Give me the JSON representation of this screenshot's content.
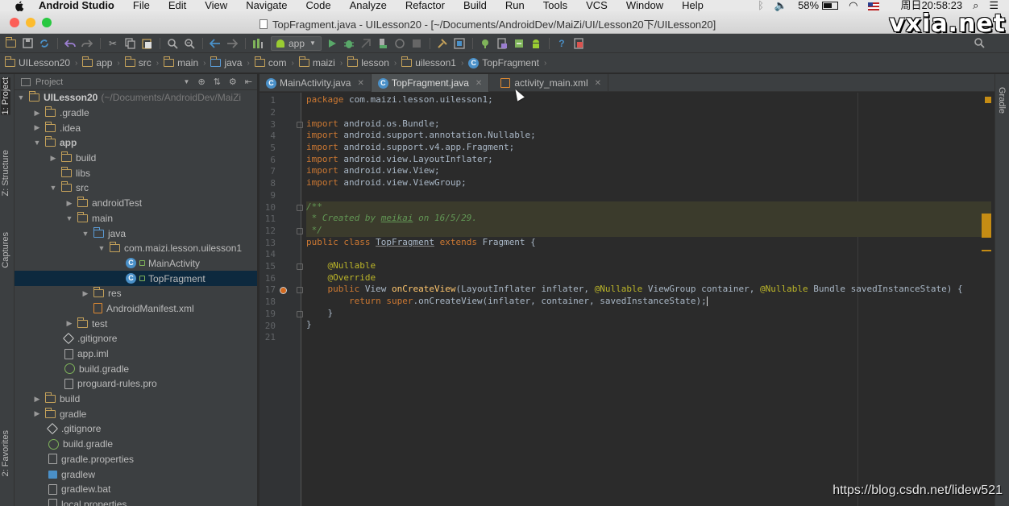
{
  "menubar": {
    "app": "Android Studio",
    "items": [
      "File",
      "Edit",
      "View",
      "Navigate",
      "Code",
      "Analyze",
      "Refactor",
      "Build",
      "Run",
      "Tools",
      "VCS",
      "Window",
      "Help"
    ],
    "battery": "58%",
    "clock": "周日20:58:23"
  },
  "window": {
    "title": "TopFragment.java - UILesson20 - [~/Documents/AndroidDev/MaiZi/UI/Lesson20下/UILesson20]"
  },
  "watermarks": {
    "top": "vxia.net",
    "bottom": "https://blog.csdn.net/lidew521"
  },
  "toolbar": {
    "run_config": "app"
  },
  "breadcrumb": [
    "UILesson20",
    "app",
    "src",
    "main",
    "java",
    "com",
    "maizi",
    "lesson",
    "uilesson1",
    "TopFragment"
  ],
  "left_tabs": {
    "project": "1: Project",
    "structure": "Z: Structure",
    "captures": "Captures",
    "favorites": "2: Favorites"
  },
  "right_tabs": {
    "gradle": "Gradle"
  },
  "project_panel": {
    "header": "Project",
    "root_name": "UILesson20",
    "root_path": "(~/Documents/AndroidDev/MaiZi",
    "items": [
      {
        "label": ".gradle"
      },
      {
        "label": ".idea"
      },
      {
        "label": "app"
      },
      {
        "label": "build"
      },
      {
        "label": "libs"
      },
      {
        "label": "src"
      },
      {
        "label": "androidTest"
      },
      {
        "label": "main"
      },
      {
        "label": "java"
      },
      {
        "label": "com.maizi.lesson.uilesson1"
      },
      {
        "label": "MainActivity"
      },
      {
        "label": "TopFragment"
      },
      {
        "label": "res"
      },
      {
        "label": "AndroidManifest.xml"
      },
      {
        "label": "test"
      },
      {
        "label": ".gitignore"
      },
      {
        "label": "app.iml"
      },
      {
        "label": "build.gradle"
      },
      {
        "label": "proguard-rules.pro"
      },
      {
        "label": "build"
      },
      {
        "label": "gradle"
      },
      {
        "label": ".gitignore"
      },
      {
        "label": "build.gradle"
      },
      {
        "label": "gradle.properties"
      },
      {
        "label": "gradlew"
      },
      {
        "label": "gradlew.bat"
      },
      {
        "label": "local.properties"
      }
    ]
  },
  "tabs": [
    {
      "label": "MainActivity.java"
    },
    {
      "label": "TopFragment.java"
    },
    {
      "label": "activity_main.xml"
    }
  ],
  "editor": {
    "line_numbers": [
      "1",
      "2",
      "3",
      "4",
      "5",
      "6",
      "7",
      "8",
      "9",
      "10",
      "11",
      "12",
      "13",
      "14",
      "15",
      "16",
      "17",
      "18",
      "19",
      "20",
      "21"
    ],
    "code": {
      "l1_kw": "package",
      "l1_rest": " com.maizi.lesson.uilesson1;",
      "l3": "android.os.Bundle;",
      "l4": "android.support.annotation.Nullable;",
      "l5": "android.support.v4.app.Fragment;",
      "l6": "android.view.LayoutInflater;",
      "l7": "android.view.View;",
      "l8": "android.view.ViewGroup;",
      "import_kw": "import",
      "l10": "/**",
      "l11_a": " * Created by ",
      "l11_author": "meikai",
      "l11_b": " on 16/5/29.",
      "l12": " */",
      "l13_kw": "public class",
      "l13_name": "TopFragment",
      "l13_ext": "extends",
      "l13_rest": " Fragment {",
      "l15": "@Nullable",
      "l16": "@Override",
      "l17_kw": "public",
      "l17_type": " View ",
      "l17_fn": "onCreateView",
      "l17_a": "(LayoutInflater inflater, ",
      "l17_ann1": "@Nullable",
      "l17_b": " ViewGroup container, ",
      "l17_ann2": "@Nullable",
      "l17_c": " Bundle savedInstanceState) {",
      "l18_kw": "return super",
      "l18_rest": ".onCreateView(inflater, container, savedInstanceState);",
      "l19": "}",
      "l20": "}"
    }
  }
}
